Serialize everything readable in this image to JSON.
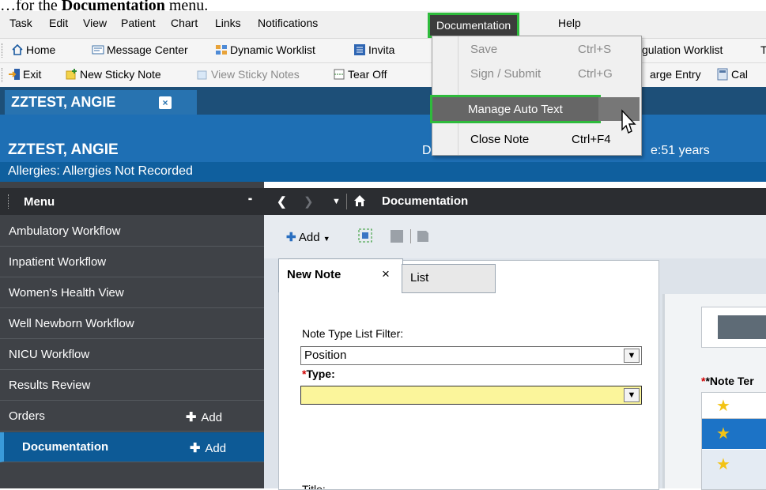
{
  "caption": {
    "prefix": "…for the ",
    "bold": "Documentation",
    "suffix": " menu."
  },
  "menubar": {
    "items": [
      "Task",
      "Edit",
      "View",
      "Patient",
      "Chart",
      "Links",
      "Notifications",
      "Documentation",
      "Help"
    ]
  },
  "toolbar1": {
    "items": [
      "Home",
      "Message Center",
      "Dynamic Worklist",
      "Invita",
      "gulation Worklist",
      "T"
    ]
  },
  "toolbar2": {
    "items": [
      "Exit",
      "New Sticky Note",
      "View Sticky Notes",
      "Tear Off",
      "arge Entry",
      "Cal"
    ]
  },
  "patient_tab": {
    "name": "ZZTEST, ANGIE",
    "close": "×"
  },
  "banner": {
    "name": "ZZTEST, ANGIE",
    "dob_fragment": "D",
    "age_fragment": "e:51 years",
    "allergies": "Allergies: Allergies Not Recorded"
  },
  "sidebar": {
    "title": "Menu",
    "pin": "ᵖ",
    "items": [
      {
        "label": "Ambulatory Workflow"
      },
      {
        "label": "Inpatient Workflow"
      },
      {
        "label": "Women's Health View"
      },
      {
        "label": "Well Newborn Workflow"
      },
      {
        "label": "NICU Workflow"
      },
      {
        "label": "Results Review"
      },
      {
        "label": "Orders",
        "add": "Add"
      },
      {
        "label": "Documentation",
        "add": "Add"
      }
    ]
  },
  "navbar": {
    "title": "Documentation"
  },
  "actions": {
    "add": "Add"
  },
  "tabs": {
    "new_note": "New Note",
    "close": "×",
    "list": "List"
  },
  "form": {
    "filter_label": "Note Type List Filter:",
    "filter_value": "Position",
    "type_required": "*",
    "type_label": "Type:",
    "type_value": "",
    "title_label": "Title:"
  },
  "right": {
    "note_templates_label": "*Note Ter"
  },
  "dropdown": {
    "items": [
      {
        "label": "Save",
        "shortcut": "Ctrl+S",
        "disabled": true
      },
      {
        "label": "Sign / Submit",
        "shortcut": "Ctrl+G",
        "disabled": true
      },
      {
        "label": "Manage Auto Text",
        "shortcut": "",
        "highlighted": true
      },
      {
        "label": "Close Note",
        "shortcut": "Ctrl+F4"
      }
    ]
  },
  "colors": {
    "highlight_border": "#2ebb3c",
    "banner": "#1e6fb4",
    "sidebar": "#3f4247"
  }
}
